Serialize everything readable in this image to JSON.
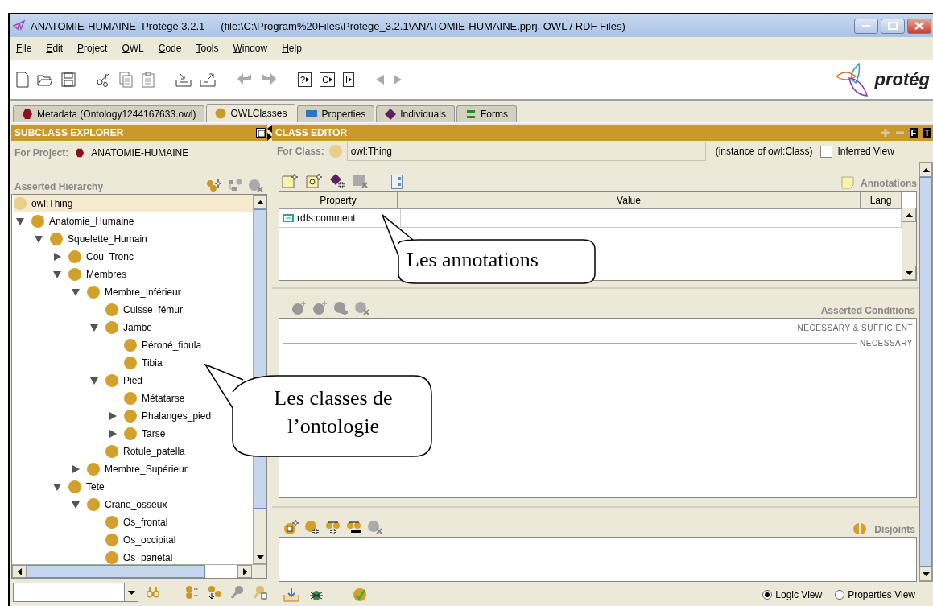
{
  "window": {
    "title": "ANATOMIE-HUMAINE  Protégé 3.2.1",
    "file": "(file:\\C:\\Program%20Files\\Protege_3.2.1\\ANATOMIE-HUMAINE.pprj, OWL / RDF Files)"
  },
  "menu": [
    "File",
    "Edit",
    "Project",
    "OWL",
    "Code",
    "Tools",
    "Window",
    "Help"
  ],
  "toolbar": {
    "letter_buttons": [
      "?",
      "C",
      "I"
    ]
  },
  "logo": {
    "text": "protég"
  },
  "tabs": [
    {
      "label": "Metadata (Ontology1244167633.owl)",
      "selected": false
    },
    {
      "label": "OWLClasses",
      "selected": true
    },
    {
      "label": "Properties",
      "selected": false
    },
    {
      "label": "Individuals",
      "selected": false
    },
    {
      "label": "Forms",
      "selected": false
    }
  ],
  "subclass_explorer": {
    "title": "SUBCLASS EXPLORER",
    "project_label": "For Project:",
    "project": "ANATOMIE-HUMAINE",
    "hierarchy_label": "Asserted Hierarchy",
    "tree": [
      {
        "label": "owl:Thing",
        "selected": true,
        "children": [
          {
            "label": "Anatomie_Humaine",
            "selected": false,
            "expanded": true,
            "children": [
              {
                "label": "Squelette_Humain",
                "selected": false,
                "expanded": true,
                "children": [
                  {
                    "label": "Cou_Tronc",
                    "selected": false,
                    "expanded": false
                  },
                  {
                    "label": "Membres",
                    "selected": false,
                    "expanded": true,
                    "children": [
                      {
                        "label": "Membre_Inférieur",
                        "selected": false,
                        "expanded": true,
                        "children": [
                          {
                            "label": "Cuisse_fémur",
                            "selected": false
                          },
                          {
                            "label": "Jambe",
                            "selected": false,
                            "expanded": true,
                            "children": [
                              {
                                "label": "Péroné_fibula",
                                "selected": false
                              },
                              {
                                "label": "Tibia",
                                "selected": false
                              }
                            ]
                          },
                          {
                            "label": "Pied",
                            "selected": false,
                            "expanded": true,
                            "children": [
                              {
                                "label": "Métatarse",
                                "selected": false
                              },
                              {
                                "label": "Phalanges_pied",
                                "selected": false,
                                "expanded": false
                              },
                              {
                                "label": "Tarse",
                                "selected": false,
                                "expanded": false
                              }
                            ]
                          },
                          {
                            "label": "Rotule_patella",
                            "selected": false
                          }
                        ]
                      },
                      {
                        "label": "Membre_Supérieur",
                        "selected": false,
                        "expanded": false
                      }
                    ]
                  },
                  {
                    "label": "Tete",
                    "selected": false,
                    "expanded": true,
                    "children": [
                      {
                        "label": "Crane_osseux",
                        "selected": false,
                        "expanded": true,
                        "children": [
                          {
                            "label": "Os_frontal",
                            "selected": false
                          },
                          {
                            "label": "Os_occipital",
                            "selected": false
                          },
                          {
                            "label": "Os_parietal",
                            "selected": false
                          }
                        ]
                      }
                    ]
                  }
                ]
              }
            ]
          }
        ]
      }
    ]
  },
  "class_editor": {
    "title": "CLASS EDITOR",
    "header_buttons": [
      "F",
      "T"
    ],
    "class_label": "For Class:",
    "class_value": "owl:Thing",
    "instance_of": "(instance of owl:Class)",
    "inferred_view": {
      "label": "Inferred View",
      "checked": false
    },
    "annotations_label": "Annotations",
    "table": {
      "columns": [
        "Property",
        "Value",
        "Lang"
      ],
      "rows": [
        {
          "property": "rdfs:comment"
        }
      ]
    },
    "conditions": {
      "title": "Asserted Conditions",
      "sections": [
        "NECESSARY & SUFFICIENT",
        "NECESSARY"
      ]
    },
    "disjoints": {
      "title": "Disjoints"
    },
    "views": [
      {
        "label": "Logic View",
        "selected": true
      },
      {
        "label": "Properties View",
        "selected": false
      }
    ]
  },
  "callouts": [
    {
      "text": "Les annotations"
    },
    {
      "text": "Les classes de l’ontologie"
    }
  ]
}
